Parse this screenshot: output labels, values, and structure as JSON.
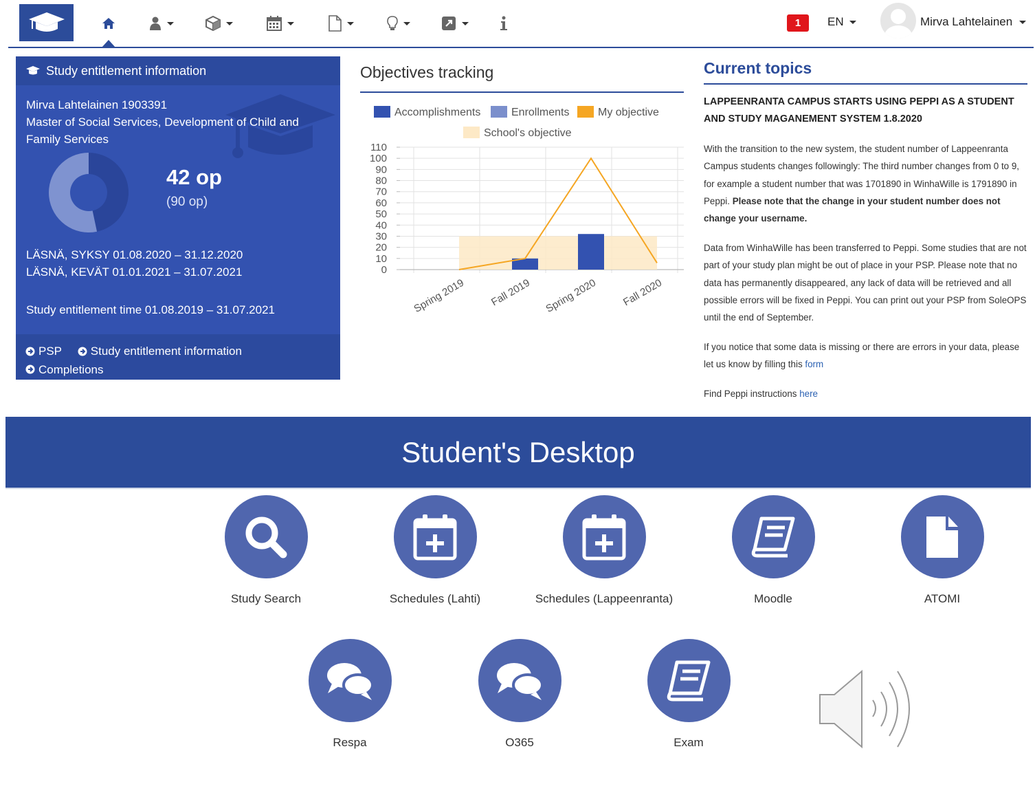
{
  "nav": {
    "notifications_count": "1",
    "language": "EN",
    "user_name": "Mirva Lahtelainen",
    "items": [
      "home-icon",
      "user-icon",
      "cube-icon",
      "calendar-icon",
      "document-icon",
      "lightbulb-icon",
      "external-link-icon",
      "info-icon"
    ],
    "accent_color": "#2c4c9a"
  },
  "study": {
    "title": "Study entitlement information",
    "student_line": "Mirva Lahtelainen 1903391",
    "degree": "Master of Social Services, Development of Child and Family Services",
    "credits_done": "42 op",
    "credits_total": "(90 op)",
    "credits_done_value": 42,
    "credits_total_value": 90,
    "status": [
      "LÄSNÄ, SYKSY 01.08.2020 – 31.12.2020",
      "LÄSNÄ, KEVÄT 01.01.2021 – 31.07.2021"
    ],
    "entitlement_time": "Study entitlement time 01.08.2019 – 31.07.2021",
    "links": {
      "psp": "PSP",
      "info": "Study entitlement information",
      "completions": "Completions"
    }
  },
  "objectives": {
    "title": "Objectives tracking"
  },
  "chart_data": {
    "type": "bar",
    "title": "",
    "categories": [
      "Spring 2019",
      "Fall 2019",
      "Spring 2020",
      "Fall 2020"
    ],
    "series": [
      {
        "name": "Accomplishments",
        "kind": "bar",
        "color": "#3352b0",
        "values": [
          0,
          10,
          32,
          0
        ]
      },
      {
        "name": "Enrollments",
        "kind": "bar",
        "color": "#7b8fcc",
        "values": [
          0,
          0,
          0,
          0
        ]
      },
      {
        "name": "My objective",
        "kind": "line",
        "color": "#f5a623",
        "values": [
          0,
          10,
          100,
          6
        ]
      },
      {
        "name": "School's objective",
        "kind": "band",
        "color": "#fde9c6",
        "values": [
          30,
          30,
          30,
          30
        ]
      }
    ],
    "ylim": [
      0,
      110
    ],
    "yticks": [
      0,
      10,
      20,
      30,
      40,
      50,
      60,
      70,
      80,
      90,
      100,
      110
    ],
    "grid": true,
    "legend_position": "top"
  },
  "topics": {
    "title": "Current topics",
    "headline": "LAPPEENRANTA CAMPUS STARTS USING PEPPI AS A STUDENT AND STUDY MAGANEMENT SYSTEM 1.8.2020",
    "p1": "With the transition to the new system, the student number of Lappeenranta Campus students changes followingly: The third number changes from 0 to 9, for example a student number that was 1701890 in WinhaWille is 1791890 in Peppi.",
    "p1_bold": "Please note that the change in your student number does not change your username.",
    "p2": "Data from WinhaWille has been transferred to Peppi. Some studies that are not part of your study plan might be out of place in your PSP. Please note that no data has permanently disappeared, any lack of data will be retrieved and all possible errors will be fixed in Peppi. You can print out your PSP from SoleOPS until the end of September.",
    "p3": "If you notice that some data is missing or there are errors in your data, please let us know by filling this",
    "p3_link": "form",
    "p4": "Find Peppi instructions",
    "p4_link": "here"
  },
  "desktop": {
    "title": "Student's Desktop",
    "tiles": [
      {
        "label": "Study Search",
        "icon": "search-icon"
      },
      {
        "label": "Schedules (Lahti)",
        "icon": "calendar-plus-icon"
      },
      {
        "label": "Schedules (Lappeenranta)",
        "icon": "calendar-plus-icon"
      },
      {
        "label": "Moodle",
        "icon": "book-icon"
      },
      {
        "label": "ATOMI",
        "icon": "document-icon"
      },
      {
        "label": "Respa",
        "icon": "chat-bubbles-icon"
      },
      {
        "label": "O365",
        "icon": "chat-bubbles-icon"
      },
      {
        "label": "Exam",
        "icon": "book-icon"
      }
    ],
    "tile_color": "#5066ae"
  }
}
